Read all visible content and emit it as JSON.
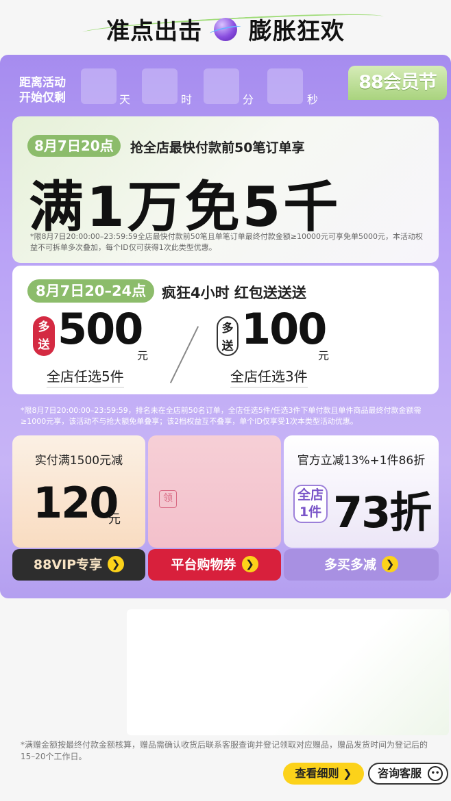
{
  "header": {
    "title_left": "准点出击",
    "title_right": "膨胀狂欢"
  },
  "countdown": {
    "label_line1": "距离活动",
    "label_line2": "开始仅剩",
    "units": [
      "天",
      "时",
      "分",
      "秒"
    ]
  },
  "vip_tag": "88会员节",
  "card1": {
    "time": "8月7日20点",
    "desc": "抢全店最快付款前50笔订单享",
    "headline": "满1万免5千",
    "note": "*限8月7日20:00:00–23:59:59全店最快付款前50笔且单笔订单最终付款金额≥10000元可享免单5000元，本活动权益不可拆单多次叠加，每个ID仅可获得1次此类型优惠。"
  },
  "card2": {
    "time": "8月7日20–24点",
    "desc": "疯狂4小时 红包送送送",
    "offers": [
      {
        "badge": "多送",
        "amount": "500",
        "unit": "元",
        "sub": "全店任选5件"
      },
      {
        "badge": "多送",
        "amount": "100",
        "unit": "元",
        "sub": "全店任选3件"
      }
    ]
  },
  "note2": "*限8月7日20:00:00–23:59:59，排名未在全店前50名订单，全店任选5件/任选3件下单付款且单件商品最终付款金额需≥1000元享，该活动不与抢大额免单叠享；该2档权益互不叠享，单个ID仅享受1次本类型活动优惠。",
  "tiles": {
    "t1": {
      "head": "实付满1500元减",
      "num": "120",
      "unit": "元",
      "button": "88VIP专享"
    },
    "t2": {
      "icon_text": "领",
      "button": "平台购物券"
    },
    "t3": {
      "head": "官方立减13%+1件86折",
      "badge_l1": "全店",
      "badge_l2": "1件",
      "num": "73折",
      "button": "多买多减"
    }
  },
  "footer": {
    "note": "*满赠金额按最终付款金额核算，赠品需确认收货后联系客服查询并登记领取对应赠品，赠品发货时间为登记后的15–20个工作日。",
    "detail_button": "查看细则",
    "service_button": "咨询客服"
  },
  "colors": {
    "accent_purple": "#a68cef",
    "green": "#8cbc6b",
    "red": "#d8203c",
    "yellow": "#fcd21a"
  }
}
